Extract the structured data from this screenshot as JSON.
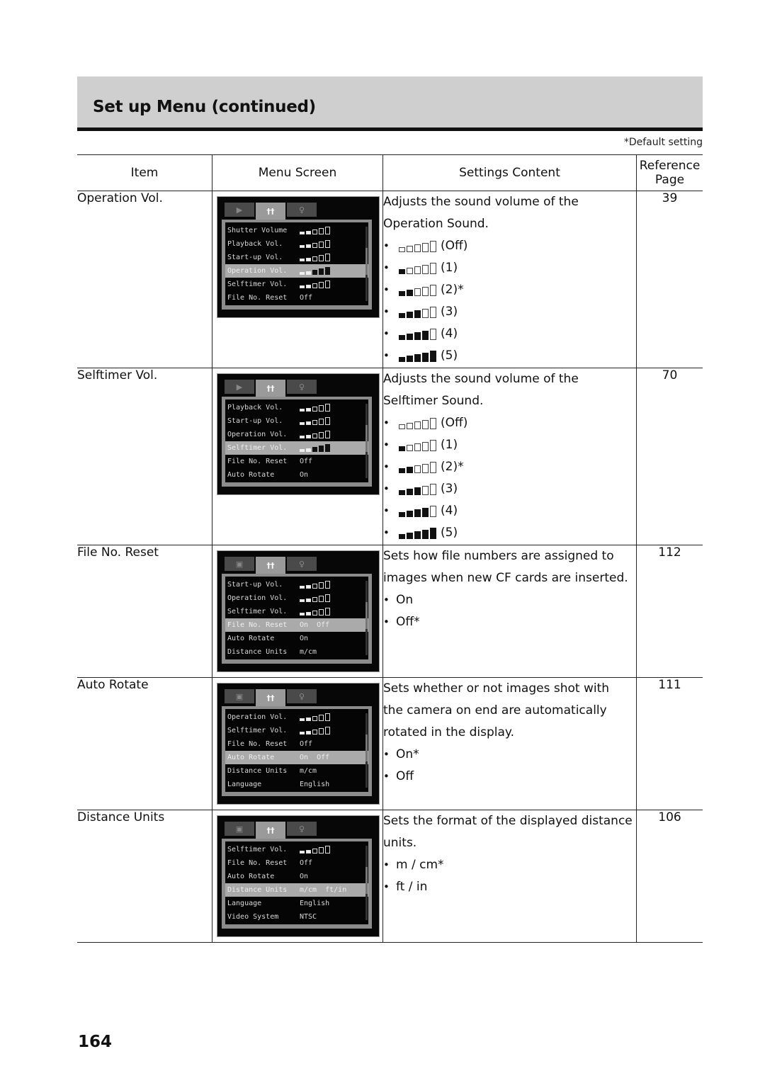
{
  "header": {
    "title": "Set up Menu (continued)"
  },
  "default_note": "*Default setting",
  "table": {
    "columns": {
      "item": "Item",
      "menu_screen": "Menu Screen",
      "settings_content": "Settings Content",
      "reference_line1": "Reference",
      "reference_line2": "Page"
    },
    "rows": [
      {
        "item": "Operation Vol.",
        "description_lines": [
          "Adjusts the sound volume of the",
          "Operation Sound."
        ],
        "options": [
          {
            "level": 0,
            "label": "(Off)"
          },
          {
            "level": 1,
            "label": "(1)"
          },
          {
            "level": 2,
            "label": "(2)*"
          },
          {
            "level": 3,
            "label": "(3)"
          },
          {
            "level": 4,
            "label": "(4)"
          },
          {
            "level": 5,
            "label": "(5)"
          }
        ],
        "page": "39",
        "screen": {
          "tabs": [
            "playback-icon",
            "setup-icon",
            "my-camera-icon"
          ],
          "rows": [
            {
              "label": "Shutter Volume",
              "vol": 2
            },
            {
              "label": "Playback Vol.",
              "vol": 2
            },
            {
              "label": "Start-up Vol.",
              "vol": 2
            },
            {
              "label": "Operation Vol.",
              "vol": 2,
              "selected": true
            },
            {
              "label": "Selftimer Vol.",
              "vol": 2
            },
            {
              "label": "File No. Reset",
              "value": "Off"
            }
          ]
        }
      },
      {
        "item": "Selftimer Vol.",
        "description_lines": [
          "Adjusts the sound volume of the",
          "Selftimer Sound."
        ],
        "options": [
          {
            "level": 0,
            "label": "(Off)"
          },
          {
            "level": 1,
            "label": "(1)"
          },
          {
            "level": 2,
            "label": "(2)*"
          },
          {
            "level": 3,
            "label": "(3)"
          },
          {
            "level": 4,
            "label": "(4)"
          },
          {
            "level": 5,
            "label": "(5)"
          }
        ],
        "page": "70",
        "screen": {
          "tabs": [
            "playback-icon",
            "setup-icon",
            "my-camera-icon"
          ],
          "rows": [
            {
              "label": "Playback Vol.",
              "vol": 2
            },
            {
              "label": "Start-up Vol.",
              "vol": 2
            },
            {
              "label": "Operation Vol.",
              "vol": 2
            },
            {
              "label": "Selftimer Vol.",
              "vol": 2,
              "selected": true
            },
            {
              "label": "File No. Reset",
              "value": "Off"
            },
            {
              "label": "Auto Rotate",
              "value": "On"
            }
          ]
        }
      },
      {
        "item": "File No. Reset",
        "description_lines": [
          "Sets how file numbers are assigned to",
          "images when new CF cards are inserted."
        ],
        "options": [
          {
            "label": "On"
          },
          {
            "label": "Off*"
          }
        ],
        "page": "112",
        "screen": {
          "tabs": [
            "camera-icon",
            "setup-icon",
            "my-camera-icon"
          ],
          "rows": [
            {
              "label": "Start-up Vol.",
              "vol": 2
            },
            {
              "label": "Operation Vol.",
              "vol": 2
            },
            {
              "label": "Selftimer Vol.",
              "vol": 2
            },
            {
              "label": "File No. Reset",
              "value": "On  Off",
              "selected": true
            },
            {
              "label": "Auto Rotate",
              "value": "On"
            },
            {
              "label": "Distance Units",
              "value": "m/cm"
            }
          ]
        }
      },
      {
        "item": "Auto Rotate",
        "description_lines": [
          "Sets whether or not images shot with",
          "the camera on end are automatically",
          "rotated in the display."
        ],
        "options": [
          {
            "label": "On*"
          },
          {
            "label": "Off"
          }
        ],
        "page": "111",
        "screen": {
          "tabs": [
            "camera-icon",
            "setup-icon",
            "my-camera-icon"
          ],
          "rows": [
            {
              "label": "Operation Vol.",
              "vol": 2
            },
            {
              "label": "Selftimer Vol.",
              "vol": 2
            },
            {
              "label": "File No. Reset",
              "value": "Off"
            },
            {
              "label": "Auto Rotate",
              "value": "On  Off",
              "selected": true
            },
            {
              "label": "Distance Units",
              "value": "m/cm"
            },
            {
              "label": "Language",
              "value": "English"
            }
          ]
        }
      },
      {
        "item": "Distance Units",
        "description_lines": [
          "Sets the format of the displayed distance",
          "units."
        ],
        "options": [
          {
            "label": "m / cm*"
          },
          {
            "label": "ft / in"
          }
        ],
        "page": "106",
        "screen": {
          "tabs": [
            "camera-icon",
            "setup-icon",
            "my-camera-icon"
          ],
          "rows": [
            {
              "label": "Selftimer Vol.",
              "vol": 2
            },
            {
              "label": "File No. Reset",
              "value": "Off"
            },
            {
              "label": "Auto Rotate",
              "value": "On"
            },
            {
              "label": "Distance Units",
              "value": "m/cm  ft/in",
              "selected": true
            },
            {
              "label": "Language",
              "value": "English"
            },
            {
              "label": "Video System",
              "value": "NTSC"
            }
          ]
        }
      }
    ]
  },
  "page_number": "164"
}
